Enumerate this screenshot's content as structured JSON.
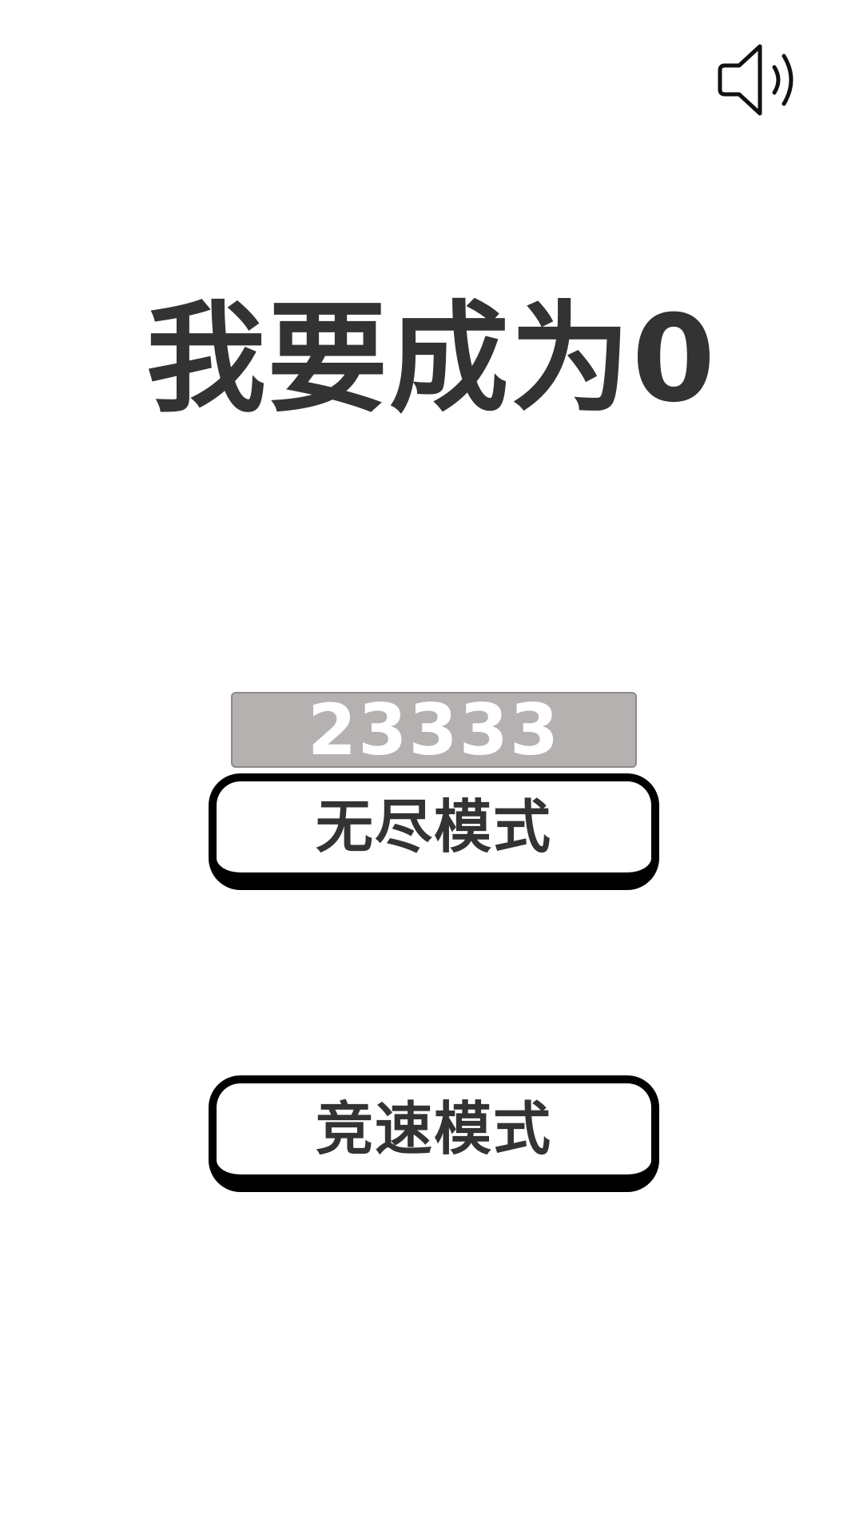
{
  "header": {
    "sound_icon": "speaker-volume-icon"
  },
  "title": "我要成为0",
  "score": "23333",
  "menu": {
    "endless_label": "无尽模式",
    "speed_label": "竞速模式"
  },
  "colors": {
    "background": "#ffffff",
    "text": "#333333",
    "score_bg": "#b6b1b1",
    "score_text": "#ffffff",
    "button_border": "#000000"
  }
}
